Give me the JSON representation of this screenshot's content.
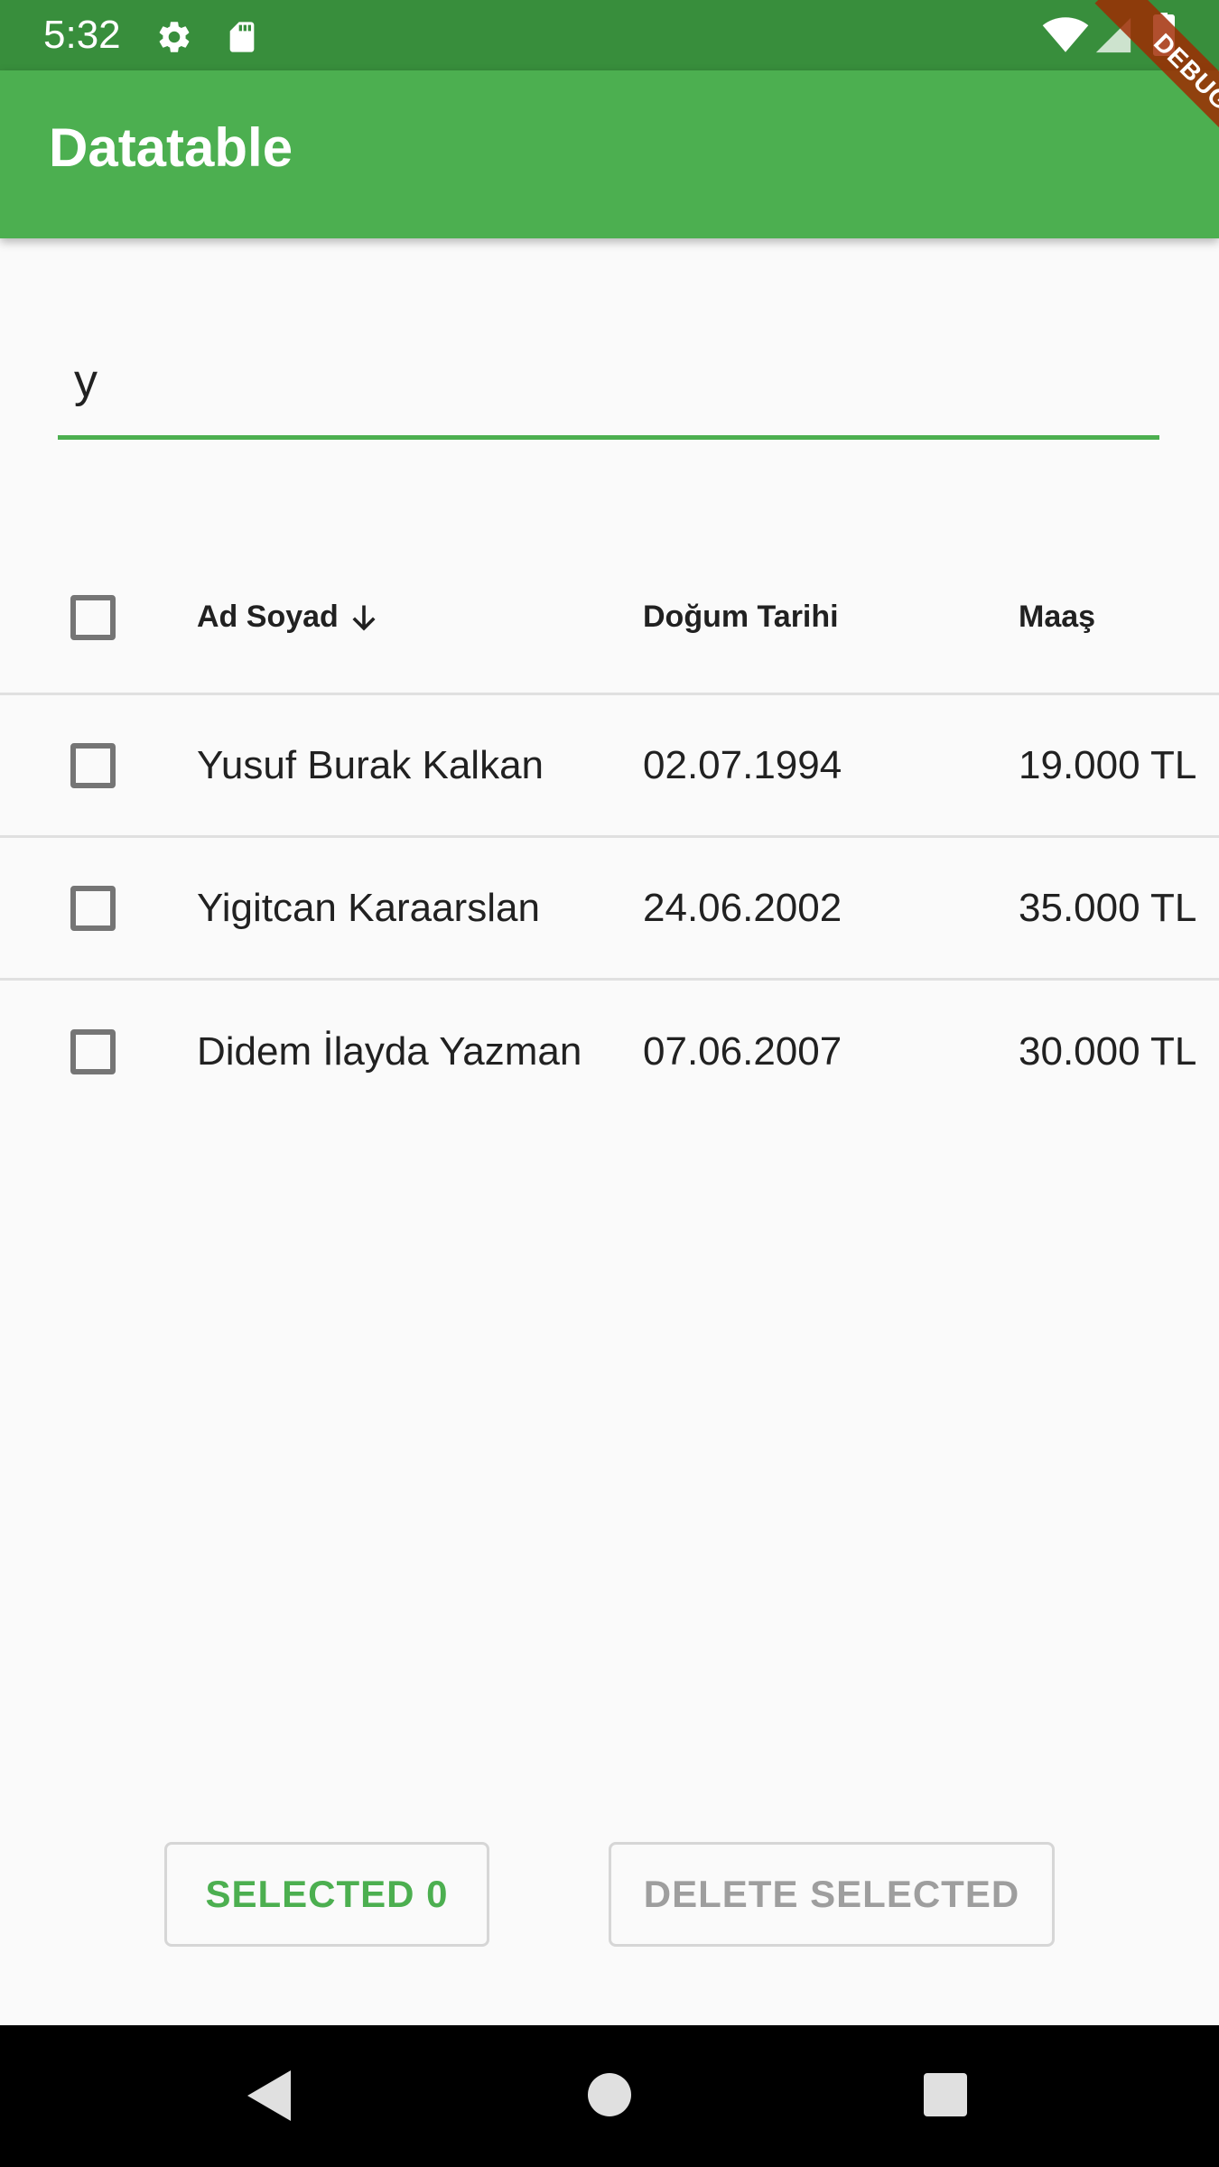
{
  "status_bar": {
    "time": "5:32",
    "icons": [
      "settings-icon",
      "sd-card-icon",
      "wifi-icon",
      "signal-icon",
      "battery-icon"
    ]
  },
  "app_bar": {
    "title": "Datatable",
    "color": "#4caf50",
    "debug_banner": "DEBUG"
  },
  "search": {
    "value": "y",
    "accent_color": "#4caf50"
  },
  "table": {
    "columns": [
      {
        "label": "Ad Soyad",
        "sorted": "descending",
        "icon": "arrow-down-icon"
      },
      {
        "label": "Doğum Tarihi"
      },
      {
        "label": "Maaş"
      }
    ],
    "rows": [
      {
        "name": "Yusuf Burak Kalkan",
        "birth_date": "02.07.1994",
        "salary": "19.000 TL",
        "selected": false
      },
      {
        "name": "Yigitcan Karaarslan",
        "birth_date": "24.06.2002",
        "salary": "35.000 TL",
        "selected": false
      },
      {
        "name": "Didem İlayda Yazman",
        "birth_date": "07.06.2007",
        "salary": "30.000 TL",
        "selected": false
      }
    ]
  },
  "actions": {
    "selected_label": "SELECTED 0",
    "delete_label": "DELETE SELECTED"
  },
  "nav_bar": {
    "icons": [
      "back-icon",
      "home-icon",
      "recents-icon"
    ]
  }
}
